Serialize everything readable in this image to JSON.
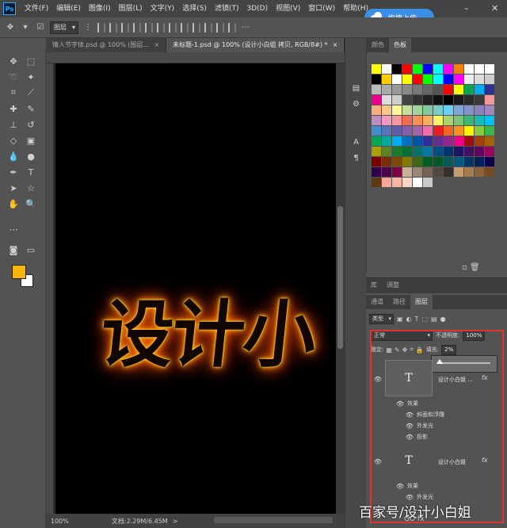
{
  "menubar": {
    "logo": "Ps",
    "items": [
      "文件(F)",
      "编辑(E)",
      "图像(I)",
      "图层(L)",
      "文字(Y)",
      "选择(S)",
      "滤镜(T)",
      "3D(D)",
      "视图(V)",
      "窗口(W)",
      "帮助(H)"
    ],
    "upload_label": "拖拽上传",
    "minimize": "–",
    "close": "✕"
  },
  "options": {
    "layer_select": "图层"
  },
  "tabs": [
    {
      "label": "情人节字体.psd @ 100% (图层…",
      "close": "×"
    },
    {
      "label": "未标题-1.psd @ 100% (设计小白姐 拷贝, RGB/8#) *",
      "close": "×"
    }
  ],
  "canvas": {
    "art_text": "设计小"
  },
  "status": {
    "zoom": "100%",
    "doc_info": "文档:2.29M/6.45M",
    "arrow": ">"
  },
  "swatches_panel": {
    "tabs": [
      "颜色",
      "色板"
    ],
    "colors": [
      "#ffff00",
      "#ffffff",
      "#000000",
      "#ff0000",
      "#00ff00",
      "#0000ff",
      "#00ffff",
      "#ff00ff",
      "#ff8000",
      "#ffffff",
      "#ffffff",
      "#ffffff",
      "#000000",
      "#ffcc00",
      "#ffffff",
      "#ffff00",
      "#ff0000",
      "#00ff00",
      "#00ffff",
      "#0000ff",
      "#ff00ff",
      "#eeeeee",
      "#dddddd",
      "#cccccc",
      "#bbbbbb",
      "#aaaaaa",
      "#999999",
      "#888888",
      "#777777",
      "#666666",
      "#555555",
      "#ff0000",
      "#ffff00",
      "#00a651",
      "#00aeef",
      "#2e3192",
      "#ec008c",
      "#dddddd",
      "#cccccc",
      "#444444",
      "#333333",
      "#222222",
      "#111111",
      "#000000",
      "#1a1a1a",
      "#2a2a2a",
      "#3a3a3a",
      "#f5989d",
      "#f9ad81",
      "#fdc68a",
      "#fff799",
      "#c4df9b",
      "#a3d39c",
      "#82ca9d",
      "#7bcdc8",
      "#6ecff6",
      "#7ea7d8",
      "#8493ca",
      "#8882be",
      "#a187be",
      "#bc8dbf",
      "#f49ac2",
      "#f6989d",
      "#f26c4f",
      "#f68e55",
      "#fbaf5c",
      "#fff467",
      "#acd372",
      "#7cc576",
      "#3bb878",
      "#1abbb4",
      "#00bff3",
      "#438ccb",
      "#5574b9",
      "#605ca8",
      "#855fa8",
      "#a763a8",
      "#f06ea9",
      "#ed1c24",
      "#f26522",
      "#f7941d",
      "#fff200",
      "#8dc73f",
      "#39b54a",
      "#00a651",
      "#00a99d",
      "#00aeef",
      "#0072bc",
      "#0054a6",
      "#2e3192",
      "#662d91",
      "#92278f",
      "#ec008c",
      "#9e0b0f",
      "#a0410d",
      "#a36209",
      "#aba000",
      "#598527",
      "#1a7b30",
      "#007236",
      "#00746b",
      "#0076a3",
      "#004b80",
      "#003471",
      "#1b1464",
      "#440e62",
      "#630460",
      "#9e005d",
      "#790000",
      "#7b2e00",
      "#7d4900",
      "#827b00",
      "#406618",
      "#005e20",
      "#005826",
      "#005952",
      "#005b7f",
      "#003663",
      "#002157",
      "#0d004c",
      "#32004b",
      "#4b0049",
      "#7b0046",
      "#c7b299",
      "#998675",
      "#736357",
      "#534741",
      "#37302a",
      "#c69c6d",
      "#a67c52",
      "#8c6239",
      "#754c24",
      "#603913",
      "#f4a896",
      "#f7b6a3",
      "#fcd5c4",
      "#ffffff",
      "#c9c9c9"
    ]
  },
  "libraries_tabs": [
    "库",
    "调整"
  ],
  "layers_panel": {
    "tabs": [
      "通道",
      "路径",
      "图层"
    ],
    "filter": "类型",
    "blend_mode": "正常",
    "opacity_label": "不透明度:",
    "opacity_value": "100%",
    "lock_label": "锁定:",
    "fill_label": "填充:",
    "fill_value": "2%",
    "layers": [
      {
        "thumb": "T",
        "name": "设计小白姐 ...",
        "fx": "fx",
        "effects_title": "效果",
        "effects": [
          "斜面和浮雕",
          "外发光",
          "投影"
        ]
      },
      {
        "thumb": "T",
        "name": "设计小白姐",
        "fx": "fx",
        "effects_title": "效果",
        "effects": [
          "外发光"
        ]
      }
    ],
    "footer": "GO fx"
  },
  "watermark": "百家号/设计小白姐"
}
